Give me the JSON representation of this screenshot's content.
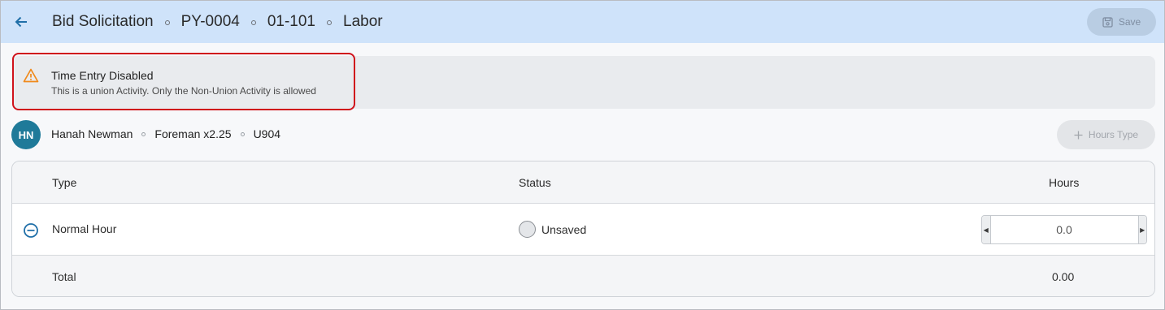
{
  "header": {
    "back_icon": "arrow-left-icon",
    "breadcrumbs": [
      "Bid Solicitation",
      "PY-0004",
      "01-101",
      "Labor"
    ],
    "save_label": "Save",
    "save_icon": "save-icon",
    "background": "#cfe3fa"
  },
  "alert": {
    "icon": "warning-icon",
    "title": "Time Entry Disabled",
    "message": "This is a union Activity. Only the Non-Union Activity is allowed",
    "highlight_color": "#d0121b"
  },
  "worker": {
    "initials": "HN",
    "name": "Hanah Newman",
    "role": "Foreman x2.25",
    "code": "U904",
    "avatar_color": "#1f7a99"
  },
  "hours_type_button": {
    "label": "Hours Type",
    "icon": "plus-icon"
  },
  "table": {
    "columns": [
      "Type",
      "Status",
      "Hours"
    ],
    "rows": [
      {
        "type": "Normal Hour",
        "status": "Unsaved",
        "hours_value": "0.0"
      }
    ],
    "total_label": "Total",
    "total_value": "0.00"
  }
}
